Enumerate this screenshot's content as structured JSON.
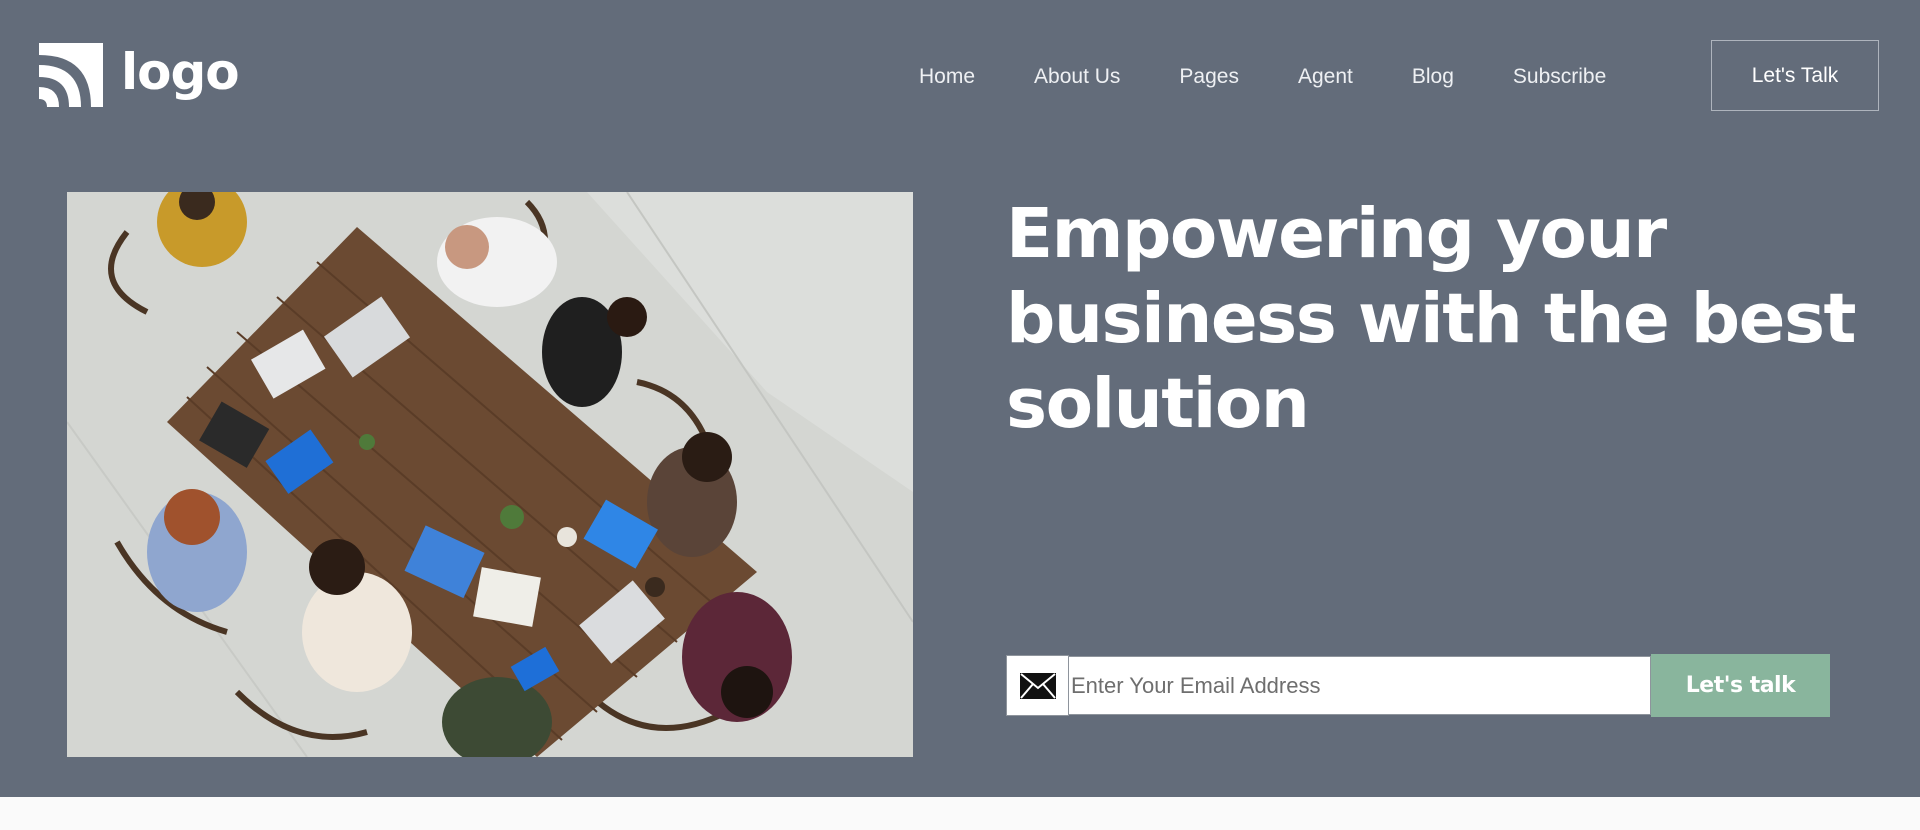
{
  "header": {
    "logo_text": "logo",
    "nav": [
      {
        "label": "Home"
      },
      {
        "label": "About Us"
      },
      {
        "label": "Pages"
      },
      {
        "label": "Agent"
      },
      {
        "label": "Blog"
      },
      {
        "label": "Subscribe"
      }
    ],
    "cta_label": "Let's Talk"
  },
  "hero": {
    "headline": "Empowering your business with the best solution",
    "image_icon": "team-meeting-photo",
    "subscribe": {
      "icon": "envelope-icon",
      "placeholder": "Enter Your Email Address",
      "value": "",
      "button_label": "Let's talk"
    }
  },
  "colors": {
    "hero_background": "#636c7a",
    "accent_button": "#89b59d",
    "page_background": "#fafafa",
    "text": "#ffffff"
  }
}
